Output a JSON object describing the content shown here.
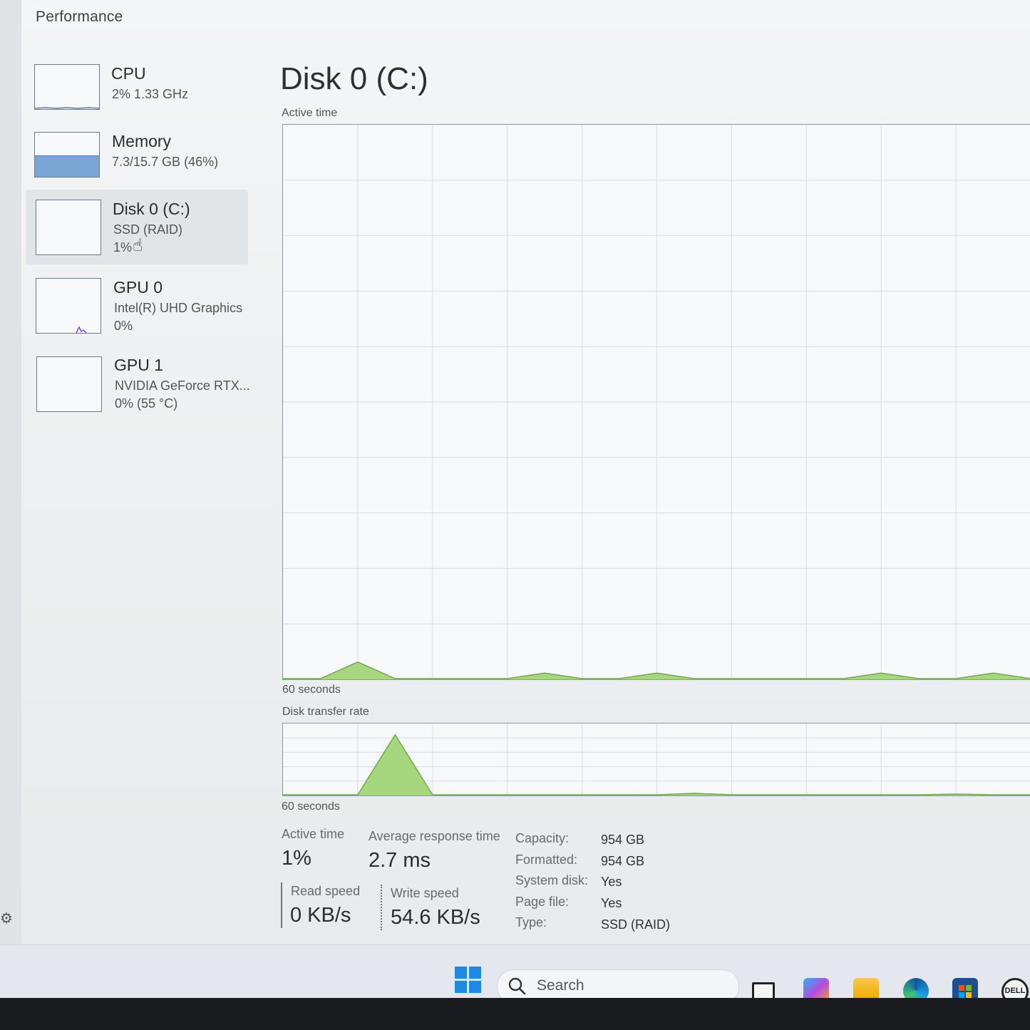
{
  "app": {
    "title": "Performance"
  },
  "sidebar": {
    "items": [
      {
        "name": "CPU",
        "sub1": "2%  1.33 GHz",
        "sub2": "",
        "color": "#1f6fb2"
      },
      {
        "name": "Memory",
        "sub1": "7.3/15.7 GB (46%)",
        "sub2": "",
        "color": "#7aa6d6"
      },
      {
        "name": "Disk 0 (C:)",
        "sub1": "SSD (RAID)",
        "sub2": "1%",
        "color": "#6cae3e"
      },
      {
        "name": "GPU 0",
        "sub1": "Intel(R) UHD Graphics",
        "sub2": "0%",
        "color": "#7b3fc4"
      },
      {
        "name": "GPU 1",
        "sub1": "NVIDIA GeForce RTX...",
        "sub2": "0%  (55 °C)",
        "color": "#7b3fc4"
      }
    ],
    "thumbnails": {
      "cpu_percent": 2,
      "memory_percent": 46,
      "disk_percent": 1,
      "gpu0_percent": 0,
      "gpu1_percent": 0
    }
  },
  "main": {
    "title": "Disk 0 (C:)",
    "active_time_label": "Active time",
    "active_time_x_label": "60 seconds",
    "transfer_rate_label": "Disk transfer rate",
    "transfer_rate_x_label": "60 seconds",
    "graph_color": "#6cae3e",
    "graph_fill": "#a6d67e"
  },
  "chart_data": [
    {
      "type": "area",
      "title": "Active time",
      "xlabel": "60 seconds",
      "x": [
        60,
        57,
        54,
        51,
        48,
        45,
        42,
        39,
        36,
        33,
        30,
        27,
        24,
        21,
        18,
        15,
        12,
        9,
        6,
        3,
        0
      ],
      "series": [
        {
          "values": [
            0,
            0,
            3,
            0,
            0,
            0,
            0,
            1,
            0,
            0,
            1,
            0,
            0,
            0,
            0,
            0,
            1,
            0,
            0,
            1,
            0
          ]
        }
      ],
      "ylim": [
        0,
        100
      ],
      "grid": true
    },
    {
      "type": "area",
      "title": "Disk transfer rate",
      "xlabel": "60 seconds",
      "x": [
        60,
        57,
        54,
        51,
        48,
        45,
        42,
        39,
        36,
        33,
        30,
        27,
        24,
        21,
        18,
        15,
        12,
        9,
        6,
        3,
        0
      ],
      "series": [
        {
          "values": [
            0,
            0,
            0,
            85,
            0,
            0,
            0,
            0,
            0,
            0,
            0,
            2,
            0,
            0,
            0,
            0,
            0,
            0,
            1,
            0,
            0
          ]
        }
      ],
      "ylim": [
        0,
        100
      ],
      "grid": true
    }
  ],
  "stats": {
    "active_time_label": "Active time",
    "active_time_value": "1%",
    "avg_response_label": "Average response time",
    "avg_response_value": "2.7 ms",
    "read_speed_label": "Read speed",
    "read_speed_value": "0 KB/s",
    "write_speed_label": "Write speed",
    "write_speed_value": "54.6 KB/s"
  },
  "properties": [
    {
      "key": "Capacity:",
      "value": "954 GB"
    },
    {
      "key": "Formatted:",
      "value": "954 GB"
    },
    {
      "key": "System disk:",
      "value": "Yes"
    },
    {
      "key": "Page file:",
      "value": "Yes"
    },
    {
      "key": "Type:",
      "value": "SSD (RAID)"
    }
  ],
  "taskbar": {
    "search_placeholder": "Search",
    "icons": [
      "windows-start-icon",
      "search-icon",
      "task-view-icon",
      "copilot-icon",
      "file-explorer-icon",
      "edge-icon",
      "store-icon",
      "dell-icon"
    ],
    "dell_text": "DELL"
  }
}
